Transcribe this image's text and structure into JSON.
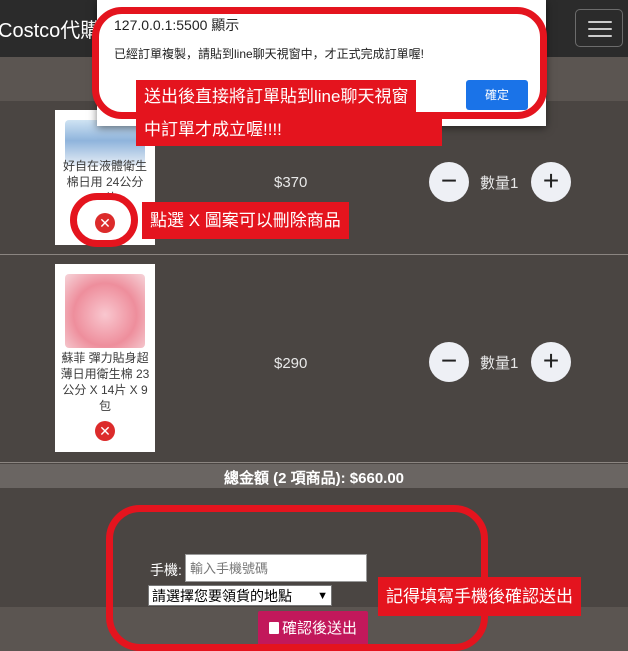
{
  "navbar": {
    "brand": "Costco代購",
    "menu_icon": "hamburger-icon"
  },
  "cart": {
    "items": [
      {
        "name": "好自在液體衛生棉日用 24公分 36片",
        "price": "$370",
        "quantity_label": "數量1",
        "remove_icon": "x-circle-icon"
      },
      {
        "name": "蘇菲 彈力貼身超薄日用衛生棉 23公分 X 14片 X 9包",
        "price": "$290",
        "quantity_label": "數量1",
        "remove_icon": "x-circle-icon"
      }
    ],
    "minus_symbol": "−",
    "plus_symbol": "+",
    "remove_symbol": "✕",
    "total": "總金額 (2 項商品): $660.00"
  },
  "form": {
    "phone_label": "手機:",
    "phone_placeholder": "輸入手機號碼",
    "phone_value": "",
    "location_selected": "請選擇您要領貨的地點",
    "submit_label": "確認後送出",
    "submit_icon": "clipboard-icon"
  },
  "alert": {
    "host": "127.0.0.1:5500 顯示",
    "message": "已經訂單複製，請貼到line聊天視窗中，才正式完成訂單喔!",
    "ok_label": "確定"
  },
  "annotations": {
    "line1": "送出後直接將訂單貼到line聊天視窗",
    "line2": "中訂單才成立喔!!!!",
    "delete_tip": "點選 X 圖案可以刪除商品",
    "phone_tip": "記得填寫手機後確認送出"
  },
  "colors": {
    "annotation_red": "#e4141e",
    "submit_magenta": "#c2185b",
    "alert_blue": "#1a73e8",
    "remove_red": "#dc2b2b"
  }
}
